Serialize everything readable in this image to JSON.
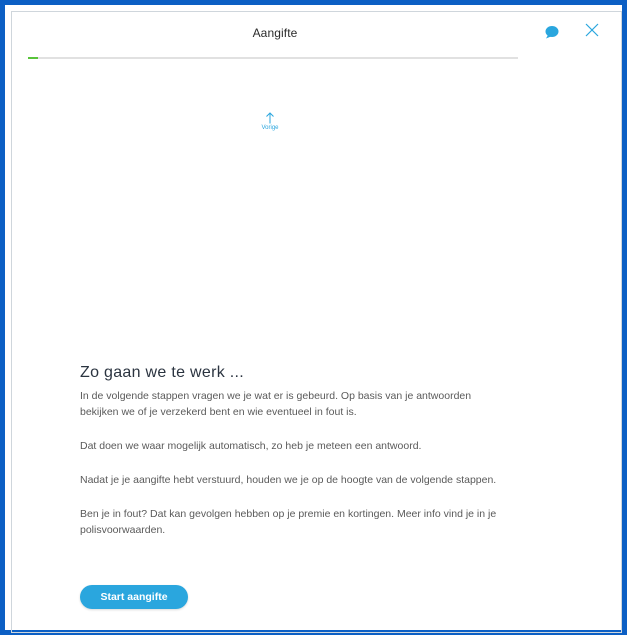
{
  "header": {
    "title": "Aangifte",
    "chat_icon": "chat-bubble-icon",
    "close_icon": "close-icon"
  },
  "progress": {
    "fraction": 0.02,
    "fill_color": "#58c43a",
    "track_color": "#e1e1e1"
  },
  "navigation": {
    "previous_label": "Vorige",
    "previous_icon": "arrow-up-icon"
  },
  "intro": {
    "heading": "Zo gaan we te werk ...",
    "paragraphs": [
      "In de volgende stappen vragen we je wat er is gebeurd. Op basis van je antwoorden bekijken we of je verzekerd bent en wie eventueel in fout is.",
      "Dat doen we waar mogelijk automatisch, zo heb je meteen een antwoord.",
      "Nadat je je aangifte hebt verstuurd, houden we je op de hoogte van de volgende stappen.",
      "Ben je in fout? Dat kan gevolgen hebben op je premie en kortingen. Meer info vind je in je polisvoorwaarden."
    ]
  },
  "actions": {
    "start_label": "Start aangifte"
  },
  "colors": {
    "frame": "#0c5fc4",
    "accent": "#2aa6de",
    "heading": "#2b3440",
    "body_text": "#5a5a5a"
  }
}
